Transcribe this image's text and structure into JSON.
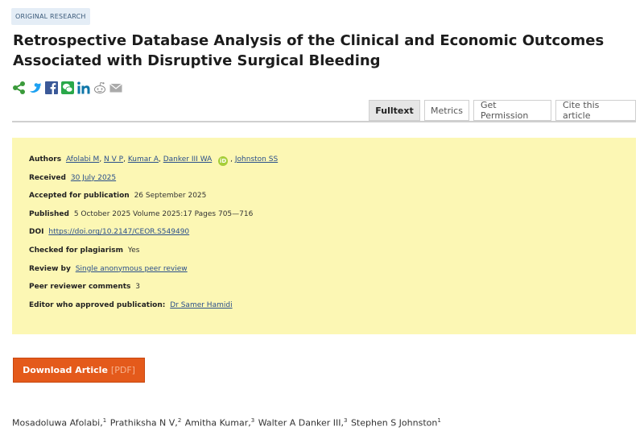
{
  "article": {
    "badge": "ORIGINAL RESEARCH",
    "title": "Retrospective Database Analysis of the Clinical and Economic Outcomes Associated with Disruptive Surgical Bleeding"
  },
  "share_icons": [
    "share-icon",
    "twitter-icon",
    "facebook-icon",
    "wechat-icon",
    "linkedin-icon",
    "reddit-icon",
    "email-icon"
  ],
  "tabs": [
    {
      "label": "Fulltext",
      "active": true
    },
    {
      "label": "Metrics",
      "active": false
    },
    {
      "label": "Get Permission",
      "active": false
    },
    {
      "label": "Cite this article",
      "active": false
    }
  ],
  "metadata": {
    "authors_label": "Authors",
    "authors": [
      "Afolabi M",
      "N V P",
      "Kumar A",
      "Danker III WA",
      "Johnston SS"
    ],
    "received_label": "Received",
    "received": "30 July 2025",
    "accepted_label": "Accepted for publication",
    "accepted": "26 September 2025",
    "published_label": "Published",
    "published": "5 October 2025 Volume 2025:17 Pages 705—716",
    "doi_label": "DOI",
    "doi": "https://doi.org/10.2147/CEOR.S549490",
    "plagiarism_label": "Checked for plagiarism",
    "plagiarism": "Yes",
    "review_label": "Review by",
    "review": "Single anonymous peer review",
    "comments_label": "Peer reviewer comments",
    "comments": "3",
    "editor_label": "Editor who approved publication:",
    "editor": "Dr Samer Hamidi"
  },
  "download": {
    "label": "Download Article",
    "format": "[PDF]"
  },
  "author_list": [
    {
      "name": "Mosadoluwa Afolabi,",
      "sup": "1"
    },
    {
      "name": "Prathiksha N V,",
      "sup": "2"
    },
    {
      "name": "Amitha Kumar,",
      "sup": "3"
    },
    {
      "name": "Walter A Danker III,",
      "sup": "3"
    },
    {
      "name": "Stephen S Johnston",
      "sup": "1"
    }
  ],
  "colors": {
    "accent": "#e45a1b",
    "meta_bg": "#fcf7b4",
    "link": "#2a4f8a",
    "orcid": "#a6ce39"
  }
}
